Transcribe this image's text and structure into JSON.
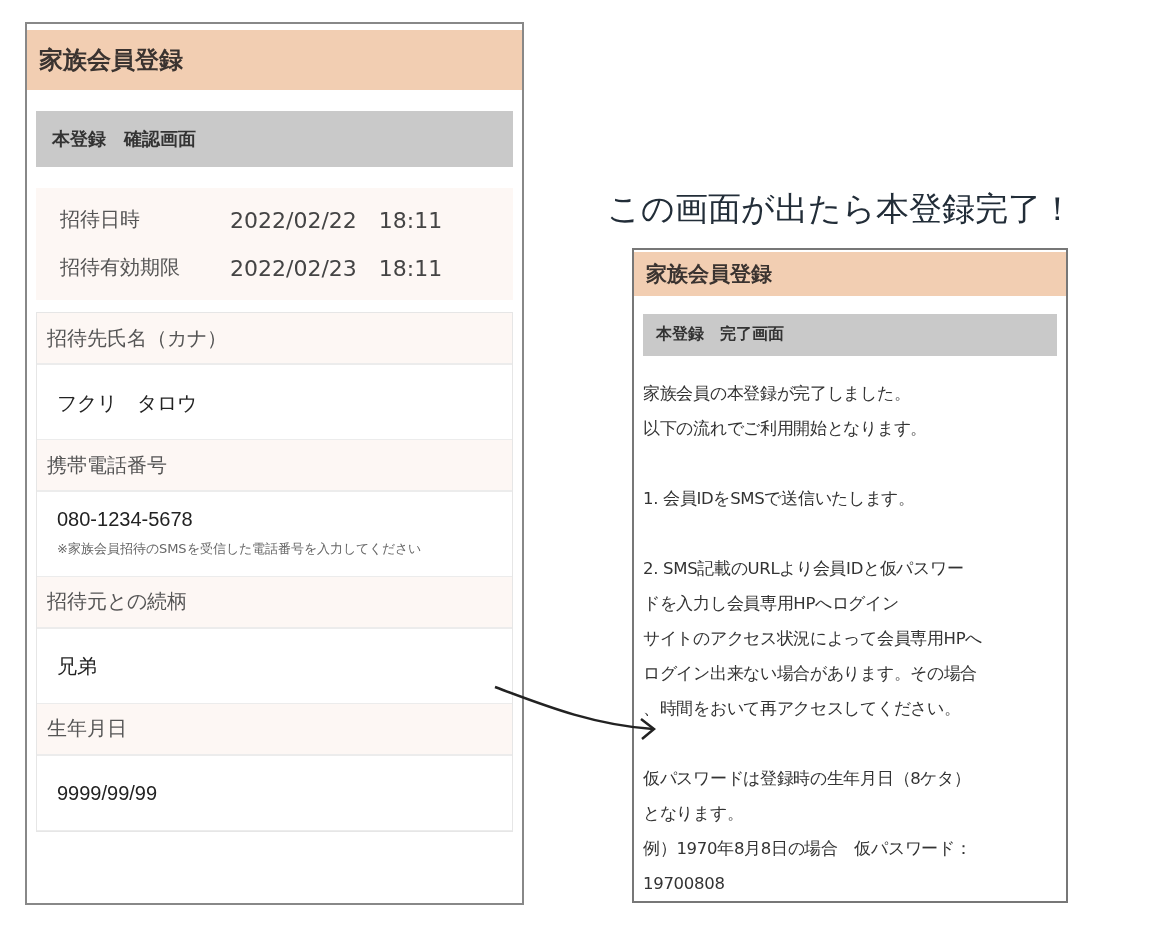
{
  "confirm_screen": {
    "title": "家族会員登録",
    "section_title": "本登録　確認画面",
    "invite_info": [
      {
        "label": "招待日時",
        "value": "2022/02/22　18:11"
      },
      {
        "label": "招待有効期限",
        "value": "2022/02/23　18:11"
      }
    ],
    "fields": [
      {
        "label": "招待先氏名（カナ）",
        "value": "フクリ　タロウ"
      },
      {
        "label": "携帯電話番号",
        "value": "080-1234-5678",
        "note": "※家族会員招待のSMSを受信した電話番号を入力してください"
      },
      {
        "label": "招待元との続柄",
        "value": "兄弟"
      },
      {
        "label": "生年月日",
        "value": "9999/99/99"
      }
    ]
  },
  "caption": "この画面が出たら本登録完了！",
  "complete_screen": {
    "title": "家族会員登録",
    "section_title": "本登録　完了画面",
    "paragraphs": [
      [
        "家族会員の本登録が完了しました。",
        "以下の流れでご利用開始となります。"
      ],
      [
        "1. 会員IDをSMSで送信いたします。"
      ],
      [
        "2. SMS記載のURLより会員IDと仮パスワー",
        "ドを入力し会員専用HPへログイン",
        "サイトのアクセス状況によって会員専用HPへ",
        "ログイン出来ない場合があります。その場合",
        "、時間をおいて再アクセスしてください。"
      ],
      [
        "仮パスワードは登録時の生年月日（8ケタ）",
        "となります。",
        "例）1970年8月8日の場合　仮パスワード：",
        "19700808"
      ]
    ]
  }
}
